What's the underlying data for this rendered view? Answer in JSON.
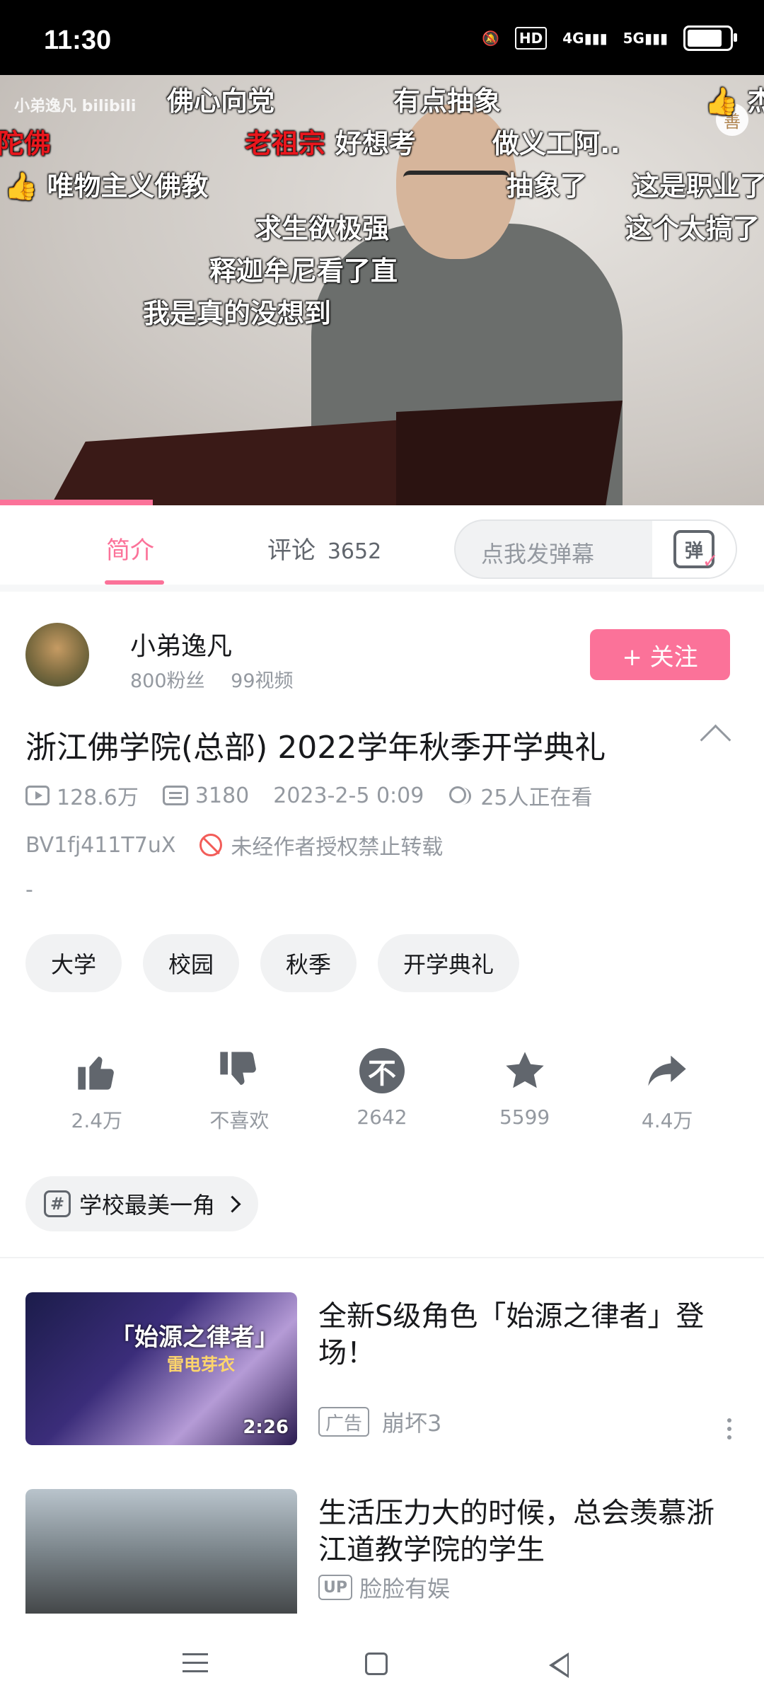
{
  "status_bar": {
    "time": "11:30",
    "icons": [
      "mute-icon",
      "hd-icon",
      "4g-signal-icon",
      "5g-signal-icon",
      "battery-icon"
    ],
    "hd_label": "HD",
    "net1": "4G",
    "net2": "5G"
  },
  "video": {
    "watermark": "小弟逸凡 bilibili",
    "badge_char": "善",
    "danmaku": [
      {
        "text": "佛心向党",
        "red": false
      },
      {
        "text": "有点抽象",
        "red": false
      },
      {
        "text": "👍 杰",
        "red": false
      },
      {
        "text": "陀佛",
        "red": true
      },
      {
        "text": "老祖宗",
        "red": true
      },
      {
        "text": "好想考",
        "red": false
      },
      {
        "text": "做义工阿..",
        "red": false
      },
      {
        "text": "👍 唯物主义佛教",
        "red": false
      },
      {
        "text": "抽象了",
        "red": false
      },
      {
        "text": "这是职业了",
        "red": false
      },
      {
        "text": "求生欲极强",
        "red": false
      },
      {
        "text": "这个太搞了",
        "red": false
      },
      {
        "text": "释迦牟尼看了直",
        "red": false
      },
      {
        "text": "我是真的没想到",
        "red": false
      }
    ],
    "progress": 0.2
  },
  "tabs": {
    "intro": "简介",
    "comments": "评论",
    "comments_count": "3652",
    "danmaku_placeholder": "点我发弹幕",
    "danmaku_button": "弹"
  },
  "author": {
    "name": "小弟逸凡",
    "fans": "800粉丝",
    "videos": "99视频",
    "follow_label": "+ 关注"
  },
  "video_info": {
    "title": "浙江佛学院(总部)   2022学年秋季开学典礼",
    "views": "128.6万",
    "danmaku_count": "3180",
    "date": "2023-2-5 0:09",
    "watching": "25人正在看",
    "bvid": "BV1fj411T7uX",
    "copyright": "未经作者授权禁止转载",
    "description": "-"
  },
  "tags": [
    "大学",
    "校园",
    "秋季",
    "开学典礼"
  ],
  "actions": [
    {
      "icon": "thumbs-up-icon",
      "label": "2.4万"
    },
    {
      "icon": "thumbs-down-icon",
      "label": "不喜欢"
    },
    {
      "icon": "coin-icon",
      "label": "2642"
    },
    {
      "icon": "star-icon",
      "label": "5599"
    },
    {
      "icon": "share-icon",
      "label": "4.4万"
    }
  ],
  "topic": "学校最美一角",
  "recommendations": [
    {
      "title": "全新S级角色「始源之律者」登场！",
      "thumb_title": "「始源之律者」",
      "thumb_sub": "雷电芽衣",
      "duration": "2:26",
      "badge": "广告",
      "author": "崩坏3"
    },
    {
      "title": "生活压力大的时候，总会羡慕浙江道教学院的学生",
      "duration": "",
      "badge": "UP",
      "author": "脸脸有娱"
    }
  ],
  "colors": {
    "accent": "#fb7299",
    "text": "#18191c",
    "muted": "#9499a0"
  }
}
